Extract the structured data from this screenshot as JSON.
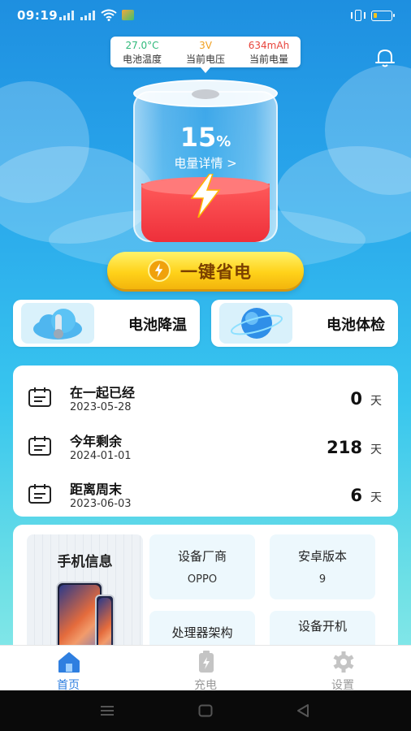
{
  "status_bar": {
    "time": "09:19"
  },
  "battery_info": {
    "temperature": {
      "value": "27.0°C",
      "label": "电池温度",
      "color": "#2fb97a"
    },
    "voltage": {
      "value": "3V",
      "label": "当前电压",
      "color": "#f0a020"
    },
    "capacity": {
      "value": "634mAh",
      "label": "当前电量",
      "color": "#e8453c"
    }
  },
  "battery_level": {
    "percent_value": "15",
    "percent_sign": "%",
    "details_link": "电量详情 >",
    "level_fraction": 0.15
  },
  "save_button": {
    "label": "一键省电"
  },
  "features": [
    {
      "label": "电池降温",
      "icon": "cloud-thermometer-icon"
    },
    {
      "label": "电池体检",
      "icon": "globe-orbit-icon"
    }
  ],
  "date_items": [
    {
      "title": "在一起已经",
      "date": "2023-05-28",
      "days": "0",
      "unit": "天"
    },
    {
      "title": "今年剩余",
      "date": "2024-01-01",
      "days": "218",
      "unit": "天"
    },
    {
      "title": "距离周末",
      "date": "2023-06-03",
      "days": "6",
      "unit": "天"
    }
  ],
  "device_info": {
    "title": "手机信息",
    "specs": [
      {
        "label": "设备厂商",
        "value": "OPPO"
      },
      {
        "label": "安卓版本",
        "value": "9"
      },
      {
        "label": "处理器架构",
        "value": ""
      },
      {
        "label": "设备开机",
        "value": ""
      }
    ]
  },
  "tabs": [
    {
      "label": "首页",
      "icon": "home-icon",
      "active": true
    },
    {
      "label": "充电",
      "icon": "charge-icon",
      "active": false
    },
    {
      "label": "设置",
      "icon": "gear-icon",
      "active": false
    }
  ],
  "colors": {
    "accent": "#2f7fe0",
    "inactive": "#9a9a9a",
    "save_button": "#ffd21a"
  }
}
